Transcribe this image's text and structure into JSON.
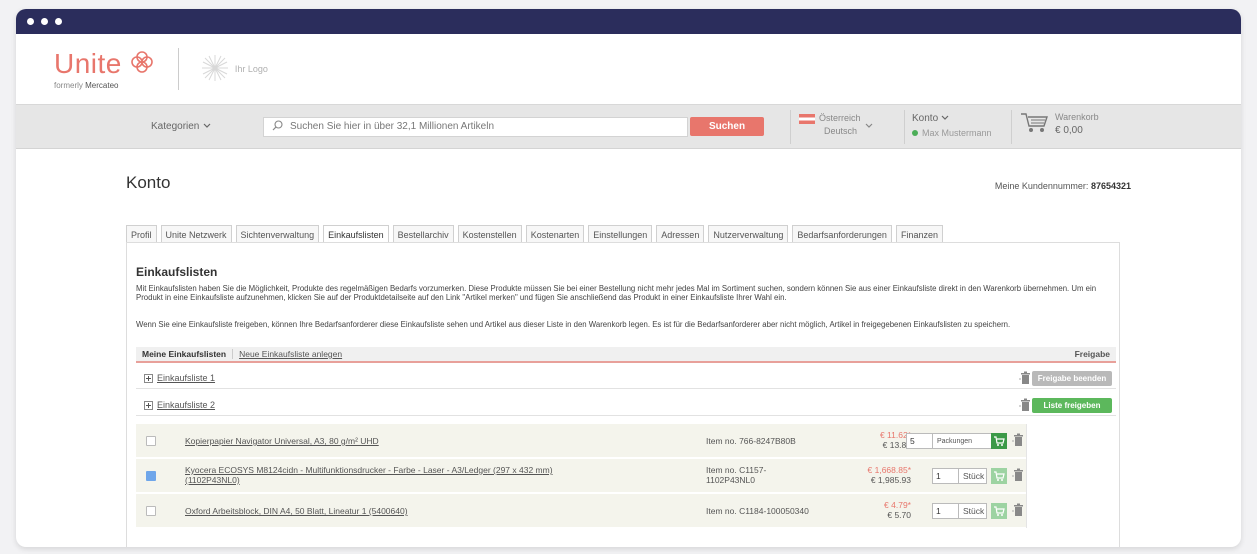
{
  "brand": {
    "logo_text": "Unite",
    "logo_sub_prefix": "formerly",
    "logo_sub_name": "Mercateo",
    "customer_logo": "Ihr Logo"
  },
  "nav": {
    "categories": "Kategorien",
    "search_placeholder": "Suchen Sie hier in über 32,1 Millionen Artikeln",
    "search_button": "Suchen",
    "country": "Österreich",
    "language": "Deutsch",
    "account": "Konto",
    "user": "Max Mustermann",
    "cart_label": "Warenkorb",
    "cart_amount": "€ 0,00"
  },
  "page": {
    "title": "Konto",
    "customer_no_label": "Meine Kundennummer:",
    "customer_no": "87654321"
  },
  "tabs": [
    {
      "label": "Profil"
    },
    {
      "label": "Unite Netzwerk"
    },
    {
      "label": "Sichtenverwaltung"
    },
    {
      "label": "Einkaufslisten",
      "active": true
    },
    {
      "label": "Bestellarchiv"
    },
    {
      "label": "Kostenstellen"
    },
    {
      "label": "Kostenarten"
    },
    {
      "label": "Einstellungen"
    },
    {
      "label": "Adressen"
    },
    {
      "label": "Nutzerverwaltung"
    },
    {
      "label": "Bedarfsanforderungen"
    },
    {
      "label": "Finanzen"
    }
  ],
  "section": {
    "heading": "Einkaufslisten",
    "desc1": "Mit Einkaufslisten haben Sie die Möglichkeit, Produkte des regelmäßigen Bedarfs vorzumerken. Diese Produkte müssen Sie bei einer Bestellung nicht mehr jedes Mal im Sortiment suchen, sondern können Sie aus einer Einkaufsliste direkt in den Warenkorb übernehmen. Um ein Produkt in eine Einkaufsliste aufzunehmen, klicken Sie auf der Produktdetailseite auf den Link \"Artikel merken\" und fügen Sie anschließend das Produkt in einer Einkaufsliste Ihrer Wahl ein.",
    "desc2": "Wenn Sie eine Einkaufsliste freigeben, können Ihre Bedarfsanforderer diese Einkaufsliste sehen und Artikel aus dieser Liste in den Warenkorb legen. Es ist für die Bedarfsanforderer aber nicht möglich, Artikel in freigegebenen Einkaufslisten zu speichern.",
    "my_lists": "Meine Einkaufslisten",
    "new_list": "Neue Einkaufsliste anlegen",
    "release_header": "Freigabe"
  },
  "lists": [
    {
      "name": "Einkaufsliste 1",
      "button": "Freigabe beenden",
      "button_color": "#b9b9b9"
    },
    {
      "name": "Einkaufsliste 2",
      "button": "Liste freigeben",
      "button_color": "#5cb85c"
    }
  ],
  "items": [
    {
      "checked": false,
      "name_line1": "Kopierpapier Navigator Universal, A3, 80 g/m² UHD",
      "name_line2": "",
      "item_no_line1": "Item no. 766-8247B80B",
      "item_no_line2": "",
      "net": "€ 11.62*",
      "gross": "€ 13.83",
      "qty": "5",
      "unit": "Packungen",
      "cart_active": true
    },
    {
      "checked": true,
      "name_line1": "Kyocera ECOSYS M8124cidn - Multifunktionsdrucker - Farbe - Laser - A3/Ledger (297 x 432 mm)",
      "name_line2": "(1102P43NL0)",
      "item_no_line1": "Item no. C1157-",
      "item_no_line2": "1102P43NL0",
      "net": "€ 1,668.85*",
      "gross": "€ 1,985.93",
      "qty": "1",
      "unit": "Stück",
      "cart_active": false
    },
    {
      "checked": false,
      "name_line1": "Oxford Arbeitsblock, DIN A4, 50 Blatt, Lineatur 1 (5400640)",
      "name_line2": "",
      "item_no_line1": "Item no. C1184-100050340",
      "item_no_line2": "",
      "net": "€ 4.79*",
      "gross": "€ 5.70",
      "qty": "1",
      "unit": "Stück",
      "cart_active": false
    }
  ]
}
